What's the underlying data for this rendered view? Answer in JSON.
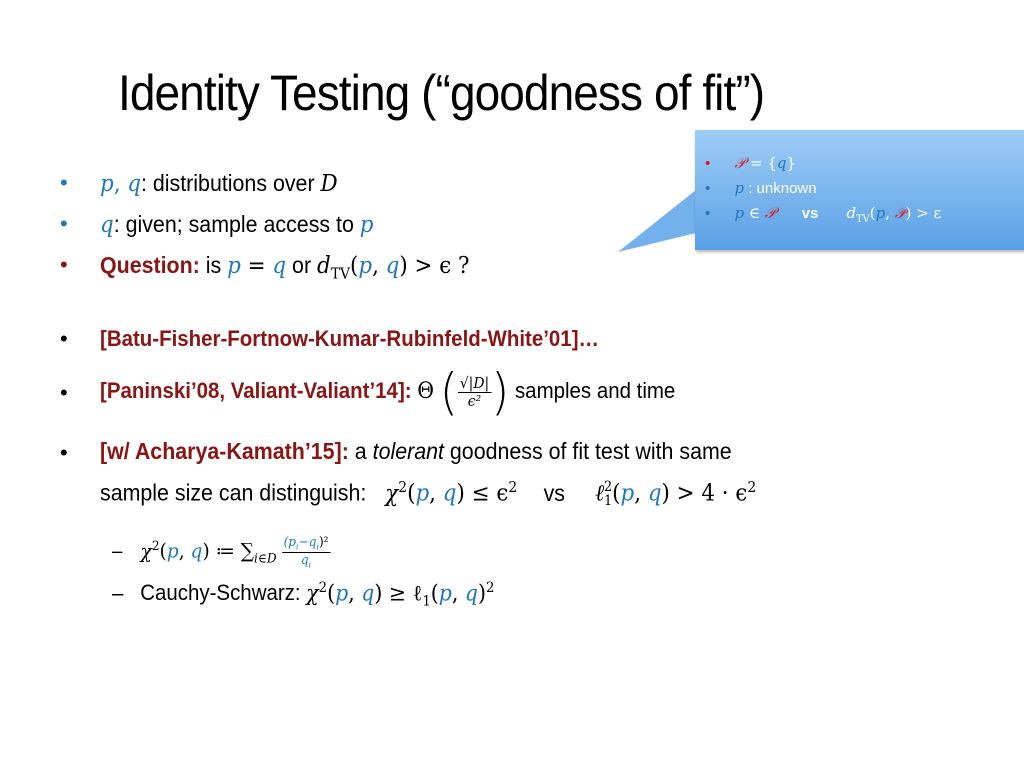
{
  "title": "Identity Testing (“goodness of fit”)",
  "callout": {
    "items": [
      {
        "calP": "𝒫",
        "eq": " = {",
        "q": "q",
        "close": "}"
      },
      {
        "p": "p",
        "text": " : unknown"
      },
      {
        "p": "p",
        "in": " ∈ ",
        "calP": "𝒫",
        "vs": "vs",
        "d": "d",
        "tv": "TV",
        "open": "(",
        "p2": "p",
        "comma": ", ",
        "calP2": "𝒫",
        "rest": ") > ε"
      }
    ]
  },
  "bullets": {
    "b1": {
      "p": "p",
      "comma": ", ",
      "q": "q",
      "text": ": distributions over ",
      "D": "D"
    },
    "b2": {
      "q": "q",
      "text": ": given; sample access to ",
      "p": "p"
    },
    "b3": {
      "label": "Question:",
      "is": " is ",
      "p": "p",
      "eq": " = ",
      "q": "q",
      "or": " or ",
      "d": "d",
      "tv": "TV",
      "open": "(",
      "p2": "p",
      "comma": ", ",
      "q2": "q",
      "rest": ") > ϵ ?"
    }
  },
  "refs": {
    "r1": "[Batu-Fisher-Fortnow-Kumar-Rubinfeld-White’01]…",
    "r2": {
      "label": "[Paninski’08, Valiant-Valiant’14]:",
      "theta": "Θ",
      "num": "√|D|",
      "den": "ϵ²",
      "text": "samples and time"
    },
    "r3": {
      "label": "[w/ Acharya-Kamath’15]:",
      "a": " a ",
      "tolerant": "tolerant",
      "text1": " goodness of fit test with same",
      "line2": "sample size can distinguish:",
      "chi": "χ",
      "two": "2",
      "open": "(",
      "p": "p",
      "comma": ", ",
      "q": "q",
      "le": ") ≤ ϵ",
      "vs": "vs",
      "ell": "ℓ",
      "one": "1",
      "p2": "p",
      "q2": "q",
      "gt": ") > 4 · ϵ"
    }
  },
  "subs": {
    "s1": {
      "dash": "–",
      "chi": "χ",
      "two": "2",
      "open": "(",
      "p": "p",
      "comma": ", ",
      "q": "q",
      "def": ") ≔ ∑",
      "sub": "i∈D",
      "num_p": "(p",
      "num_i": "i",
      "num_minus": "−q",
      "num_close": ")²",
      "den_q": "q",
      "den_i": "i"
    },
    "s2": {
      "dash": "–",
      "label": "Cauchy-Schwarz: ",
      "chi": "χ",
      "two": "2",
      "open": "(",
      "p": "p",
      "comma": ", ",
      "q": "q",
      "ge": ") ≥ ℓ",
      "one": "1",
      "open2": "(",
      "p2": "p",
      "q2": "q",
      "close": ")"
    }
  },
  "bullet_char": "•",
  "colors": {
    "math_blue": "#1F77C0",
    "ref_red": "#8B1414",
    "set_red": "#E0141E",
    "callout_top": "#9ECDF6",
    "callout_bottom": "#5AA0E6"
  }
}
